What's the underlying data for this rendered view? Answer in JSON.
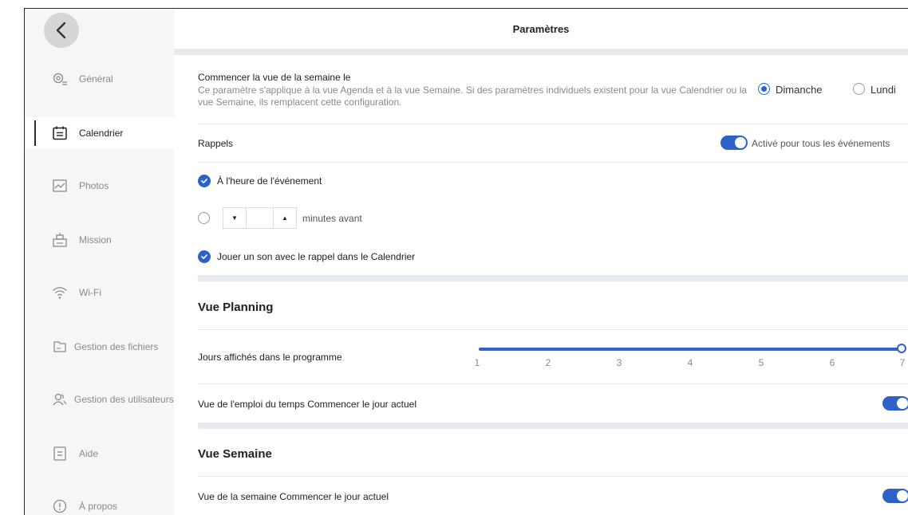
{
  "header": {
    "title": "Paramètres"
  },
  "sidebar": {
    "items": [
      {
        "label": "Général",
        "icon": "gear-icon"
      },
      {
        "label": "Calendrier",
        "icon": "calendar-icon"
      },
      {
        "label": "Photos",
        "icon": "photo-icon"
      },
      {
        "label": "Mission",
        "icon": "mission-icon"
      },
      {
        "label": "Wi-Fi",
        "icon": "wifi-icon"
      },
      {
        "label": "Gestion des fichiers",
        "icon": "folder-icon"
      },
      {
        "label": "Gestion des utilisateurs",
        "icon": "users-icon"
      },
      {
        "label": "Aide",
        "icon": "help-icon"
      },
      {
        "label": "À propos",
        "icon": "info-icon"
      }
    ],
    "active_item": "Calendrier"
  },
  "week_start": {
    "title": "Commencer la vue de la semaine le",
    "description": "Ce paramètre s'applique à la vue Agenda et à la vue Semaine. Si des paramètres individuels existent pour la vue Calendrier ou la vue Semaine, ils remplacent cette configuration.",
    "options": [
      "Dimanche",
      "Lundi"
    ],
    "selected": "Dimanche"
  },
  "reminders": {
    "title": "Rappels",
    "toggle_label": "Activé pour tous les événements",
    "toggle_on": true,
    "at_event_label": "À l'heure de l'événement",
    "at_event_checked": true,
    "minutes_label": "minutes avant",
    "minutes_value": "",
    "sound_label": "Jouer un son avec le rappel dans le Calendrier",
    "sound_checked": true
  },
  "planning": {
    "heading": "Vue Planning",
    "days_label": "Jours affichés dans le programme",
    "ticks": [
      "1",
      "2",
      "3",
      "4",
      "5",
      "6",
      "7"
    ],
    "days_value": 7,
    "schedule_today_label": "Vue de l'emploi du temps Commencer le jour actuel",
    "schedule_today_on": true
  },
  "week_view": {
    "heading": "Vue Semaine",
    "week_today_label": "Vue de la semaine Commencer le jour actuel",
    "week_today_on": true
  },
  "colors": {
    "accent": "#2e62c9",
    "band": "#e7ebf0",
    "sidebar": "#f6f6f6"
  }
}
